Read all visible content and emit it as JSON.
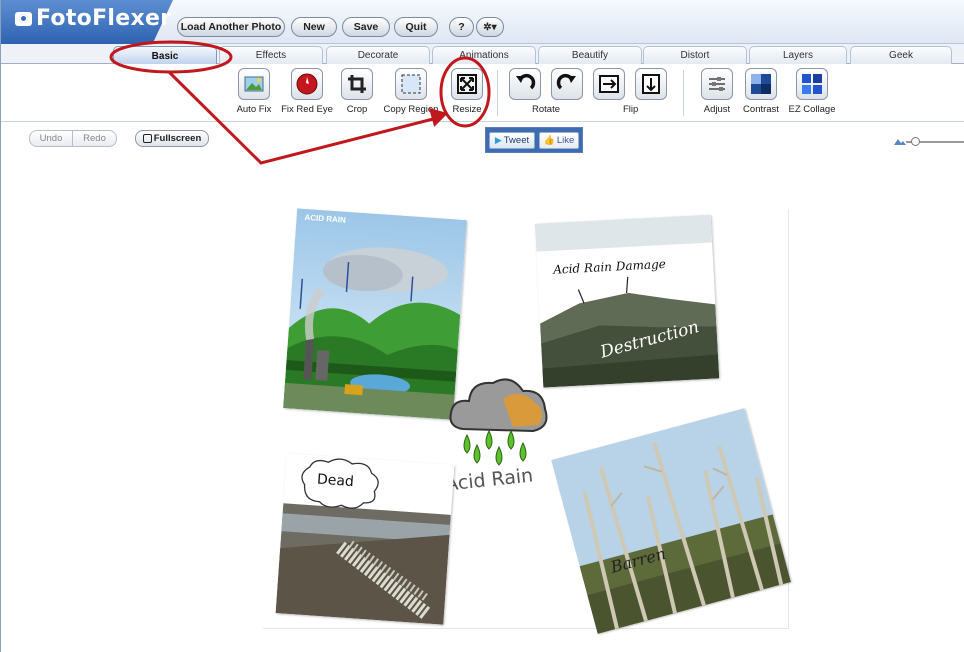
{
  "app": {
    "logo": "FotoFlexer"
  },
  "topbar": {
    "load_another_photo": "Load Another Photo",
    "new": "New",
    "save": "Save",
    "quit": "Quit",
    "help": "?",
    "settings": "✲▾"
  },
  "tabs": [
    "Basic",
    "Effects",
    "Decorate",
    "Animations",
    "Beautify",
    "Distort",
    "Layers",
    "Geek"
  ],
  "active_tab": "Basic",
  "tools": {
    "auto_fix": "Auto Fix",
    "fix_red_eye": "Fix Red Eye",
    "crop": "Crop",
    "copy_region": "Copy Region",
    "resize": "Resize",
    "rotate": "Rotate",
    "flip": "Flip",
    "adjust": "Adjust",
    "contrast": "Contrast",
    "ez_collage": "EZ Collage"
  },
  "subbar": {
    "undo": "Undo",
    "redo": "Redo",
    "fullscreen": "Fullscreen",
    "tweet": "Tweet",
    "like": "Like"
  },
  "canvas": {
    "photo_acid_rain_title": "ACID RAIN",
    "photo_damage_caption": "Acid Rain Damage",
    "photo_destruction_caption": "Destruction",
    "photo_dead_caption": "Dead",
    "center_caption": "Acid Rain",
    "photo_barren_caption": "Barren"
  },
  "colors": {
    "brand_blue": "#3a6cbf",
    "annotation_red": "#c0181c",
    "active_tab": "#bcd0ec"
  }
}
